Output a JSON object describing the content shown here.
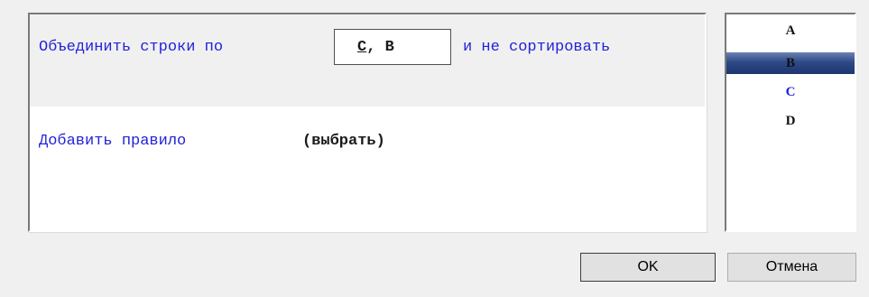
{
  "rules": {
    "merge_rule": {
      "prefix": "Объединить строки по",
      "columns_first": "C",
      "columns_rest": ", B",
      "suffix": "и не сортировать"
    },
    "add_rule_label": "Добавить правило",
    "choose_label": "(выбрать)"
  },
  "column_list": {
    "items": [
      {
        "label": "A",
        "state": "normal"
      },
      {
        "label": "B",
        "state": "selected"
      },
      {
        "label": "C",
        "state": "available"
      },
      {
        "label": "D",
        "state": "normal"
      }
    ]
  },
  "buttons": {
    "ok_label": "OK",
    "cancel_label": "Отмена"
  },
  "colors": {
    "link_blue": "#2323d9",
    "selection": "#2e4a86",
    "panel_bg": "#f0f0f0"
  }
}
